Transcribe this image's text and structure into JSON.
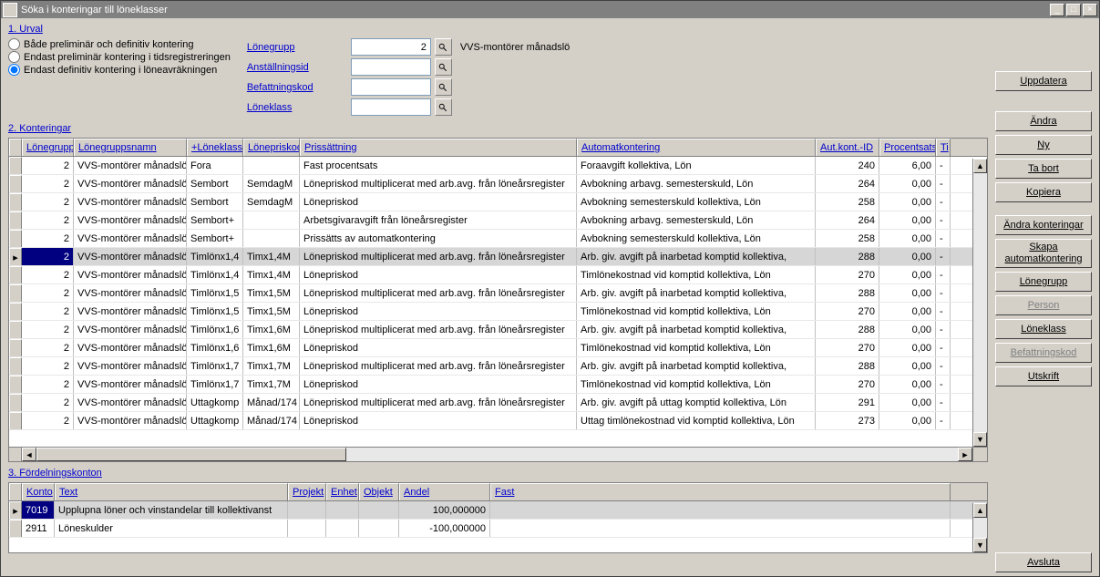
{
  "window": {
    "title": "Söka i konteringar till löneklasser"
  },
  "urval": {
    "heading": "1. Urval",
    "radios": [
      "Både preliminär och definitiv kontering",
      "Endast preliminär kontering i tidsregistreringen",
      "Endast definitiv kontering i löneavräkningen"
    ],
    "selected": 2,
    "fields": [
      {
        "label": "Lönegrupp",
        "value": "2",
        "result": "VVS-montörer månadslö"
      },
      {
        "label": "Anställningsid",
        "value": "",
        "result": ""
      },
      {
        "label": "Befattningskod",
        "value": "",
        "result": ""
      },
      {
        "label": "Löneklass",
        "value": "",
        "result": ""
      }
    ]
  },
  "buttons": {
    "uppdatera": "Uppdatera",
    "andra": "Ändra",
    "ny": "Ny",
    "tabort": "Ta bort",
    "kopiera": "Kopiera",
    "andra_kont": "Ändra konteringar",
    "skapa_auto": "Skapa\nautomatkontering",
    "lonegrupp": "Lönegrupp",
    "person": "Person",
    "loneklass": "Löneklass",
    "befattning": "Befattningskod",
    "utskrift": "Utskrift",
    "avsluta": "Avsluta"
  },
  "grid1": {
    "heading": "2. Konteringar",
    "headers": [
      "Lönegrupp",
      "Lönegruppsnamn",
      "+Löneklass",
      "Lönepriskod",
      "Prissättning",
      "Automatkontering",
      "Aut.kont.-ID",
      "Procentsats",
      "Ti"
    ],
    "selected_index": 5,
    "rows": [
      [
        "2",
        "VVS-montörer månadslön",
        "Fora",
        "",
        "Fast procentsats",
        "Foraavgift kollektiva, Lön",
        "240",
        "6,00",
        "-"
      ],
      [
        "2",
        "VVS-montörer månadslön",
        "Sembort",
        "SemdagM",
        "Lönepriskod multiplicerat med arb.avg. från löneårsregister",
        "Avbokning arbavg. semesterskuld, Lön",
        "264",
        "0,00",
        "-"
      ],
      [
        "2",
        "VVS-montörer månadslön",
        "Sembort",
        "SemdagM",
        "Lönepriskod",
        "Avbokning semesterskuld kollektiva, Lön",
        "258",
        "0,00",
        "-"
      ],
      [
        "2",
        "VVS-montörer månadslön",
        "Sembort+",
        "",
        "Arbetsgivaravgift från löneårsregister",
        "Avbokning arbavg. semesterskuld, Lön",
        "264",
        "0,00",
        "-"
      ],
      [
        "2",
        "VVS-montörer månadslön",
        "Sembort+",
        "",
        "Prissätts av automatkontering",
        "Avbokning semesterskuld kollektiva, Lön",
        "258",
        "0,00",
        "-"
      ],
      [
        "2",
        "VVS-montörer månadslön",
        "Timlönx1,4",
        "Timx1,4M",
        "Lönepriskod multiplicerat med arb.avg. från löneårsregister",
        "Arb. giv. avgift på inarbetad komptid kollektiva,",
        "288",
        "0,00",
        "-"
      ],
      [
        "2",
        "VVS-montörer månadslön",
        "Timlönx1,4",
        "Timx1,4M",
        "Lönepriskod",
        "Timlönekostnad vid komptid kollektiva, Lön",
        "270",
        "0,00",
        "-"
      ],
      [
        "2",
        "VVS-montörer månadslön",
        "Timlönx1,5",
        "Timx1,5M",
        "Lönepriskod multiplicerat med arb.avg. från löneårsregister",
        "Arb. giv. avgift på inarbetad komptid kollektiva,",
        "288",
        "0,00",
        "-"
      ],
      [
        "2",
        "VVS-montörer månadslön",
        "Timlönx1,5",
        "Timx1,5M",
        "Lönepriskod",
        "Timlönekostnad vid komptid kollektiva, Lön",
        "270",
        "0,00",
        "-"
      ],
      [
        "2",
        "VVS-montörer månadslön",
        "Timlönx1,6",
        "Timx1,6M",
        "Lönepriskod multiplicerat med arb.avg. från löneårsregister",
        "Arb. giv. avgift på inarbetad komptid kollektiva,",
        "288",
        "0,00",
        "-"
      ],
      [
        "2",
        "VVS-montörer månadslön",
        "Timlönx1,6",
        "Timx1,6M",
        "Lönepriskod",
        "Timlönekostnad vid komptid kollektiva, Lön",
        "270",
        "0,00",
        "-"
      ],
      [
        "2",
        "VVS-montörer månadslön",
        "Timlönx1,7",
        "Timx1,7M",
        "Lönepriskod multiplicerat med arb.avg. från löneårsregister",
        "Arb. giv. avgift på inarbetad komptid kollektiva,",
        "288",
        "0,00",
        "-"
      ],
      [
        "2",
        "VVS-montörer månadslön",
        "Timlönx1,7",
        "Timx1,7M",
        "Lönepriskod",
        "Timlönekostnad vid komptid kollektiva, Lön",
        "270",
        "0,00",
        "-"
      ],
      [
        "2",
        "VVS-montörer månadslön",
        "Uttagkomp",
        "Månad/174",
        "Lönepriskod multiplicerat med arb.avg. från löneårsregister",
        "Arb. giv. avgift på uttag komptid kollektiva, Lön",
        "291",
        "0,00",
        "-"
      ],
      [
        "2",
        "VVS-montörer månadslön",
        "Uttagkomp",
        "Månad/174",
        "Lönepriskod",
        "Uttag timlönekostnad vid komptid kollektiva, Lön",
        "273",
        "0,00",
        "-"
      ]
    ]
  },
  "grid2": {
    "heading": "3. Fördelningskonton",
    "headers": [
      "Konto",
      "Text",
      "Projekt",
      "Enhet",
      "Objekt",
      "Andel",
      "Fast"
    ],
    "rows": [
      [
        "7019",
        "Upplupna löner och vinstandelar till kollektivanst",
        "",
        "",
        "",
        "100,000000",
        ""
      ],
      [
        "2911",
        "Löneskulder",
        "",
        "",
        "",
        "-100,000000",
        ""
      ]
    ]
  }
}
